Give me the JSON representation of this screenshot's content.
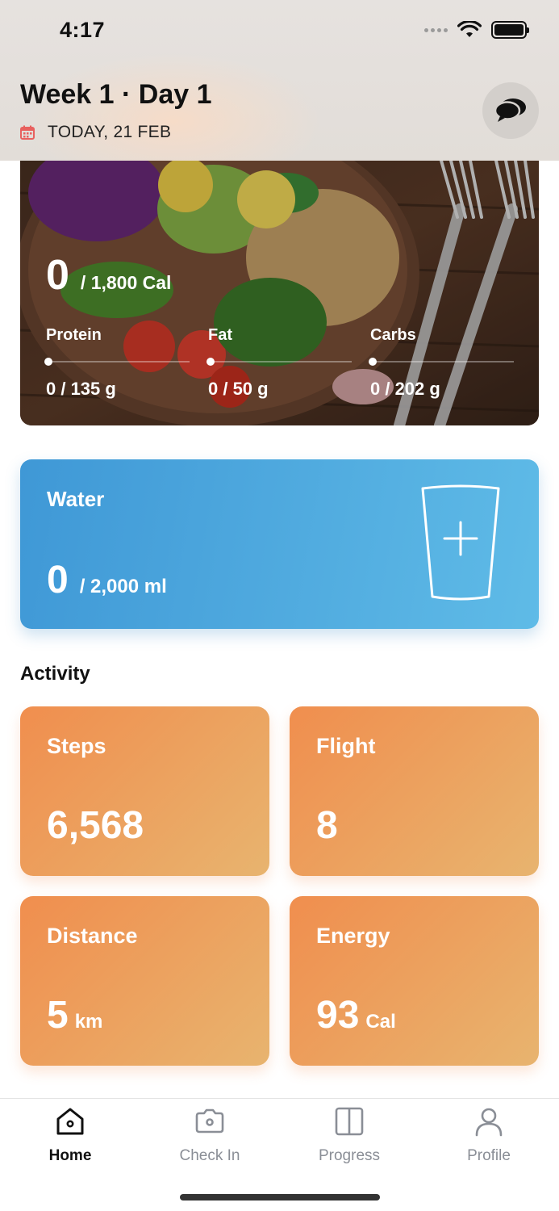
{
  "status_bar": {
    "time": "4:17"
  },
  "header": {
    "title": "Week 1 · Day 1",
    "date": "TODAY, 21 FEB",
    "icons": {
      "calendar": "calendar-icon",
      "chat": "chat-bubbles-icon"
    },
    "colors": {
      "calendar": "#e8605e"
    }
  },
  "nutrition": {
    "calories_value": "0",
    "calories_target": "/ 1,800 Cal",
    "macros": [
      {
        "label": "Protein",
        "value": "0 / 135 g",
        "progress": 0
      },
      {
        "label": "Fat",
        "value": "0 / 50 g",
        "progress": 0
      },
      {
        "label": "Carbs",
        "value": "0 / 202 g",
        "progress": 0
      }
    ]
  },
  "water": {
    "title": "Water",
    "value": "0",
    "target": "/  2,000 ml",
    "icon": "add-glass-icon",
    "colors": {
      "start": "#3f98d6",
      "end": "#5fbbe7"
    }
  },
  "activity": {
    "title": "Activity",
    "cards": [
      {
        "label": "Steps",
        "value": "6,568",
        "unit": ""
      },
      {
        "label": "Flight",
        "value": "8",
        "unit": ""
      },
      {
        "label": "Distance",
        "value": "5",
        "unit": "km"
      },
      {
        "label": "Energy",
        "value": "93",
        "unit": "Cal"
      }
    ],
    "colors": {
      "start": "#f08e4e",
      "end": "#e8b46f"
    }
  },
  "tabbar": {
    "tabs": [
      {
        "label": "Home",
        "icon": "home-icon",
        "active": true
      },
      {
        "label": "Check In",
        "icon": "camera-icon",
        "active": false
      },
      {
        "label": "Progress",
        "icon": "book-icon",
        "active": false
      },
      {
        "label": "Profile",
        "icon": "user-icon",
        "active": false
      }
    ]
  }
}
